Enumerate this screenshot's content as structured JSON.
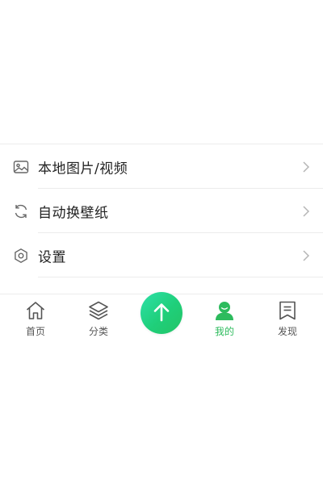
{
  "menu": {
    "items": [
      {
        "label": "本地图片/视频",
        "icon": "image-icon"
      },
      {
        "label": "自动换壁纸",
        "icon": "refresh-icon"
      },
      {
        "label": "设置",
        "icon": "gear-icon"
      }
    ]
  },
  "tabbar": {
    "tabs": [
      {
        "label": "首页",
        "icon": "home-icon"
      },
      {
        "label": "分类",
        "icon": "layers-icon"
      },
      {
        "label": "我的",
        "icon": "user-icon",
        "active": true
      },
      {
        "label": "发现",
        "icon": "bookmark-list-icon"
      }
    ],
    "center_button": {
      "icon": "upload-arrow-icon"
    }
  },
  "colors": {
    "accent": "#2dbb5d",
    "upload_gradient_start": "#2ee0a8",
    "upload_gradient_end": "#24c466",
    "text_primary": "#222222",
    "text_secondary": "#555555",
    "divider": "#ececec",
    "icon_gray": "#666666"
  }
}
